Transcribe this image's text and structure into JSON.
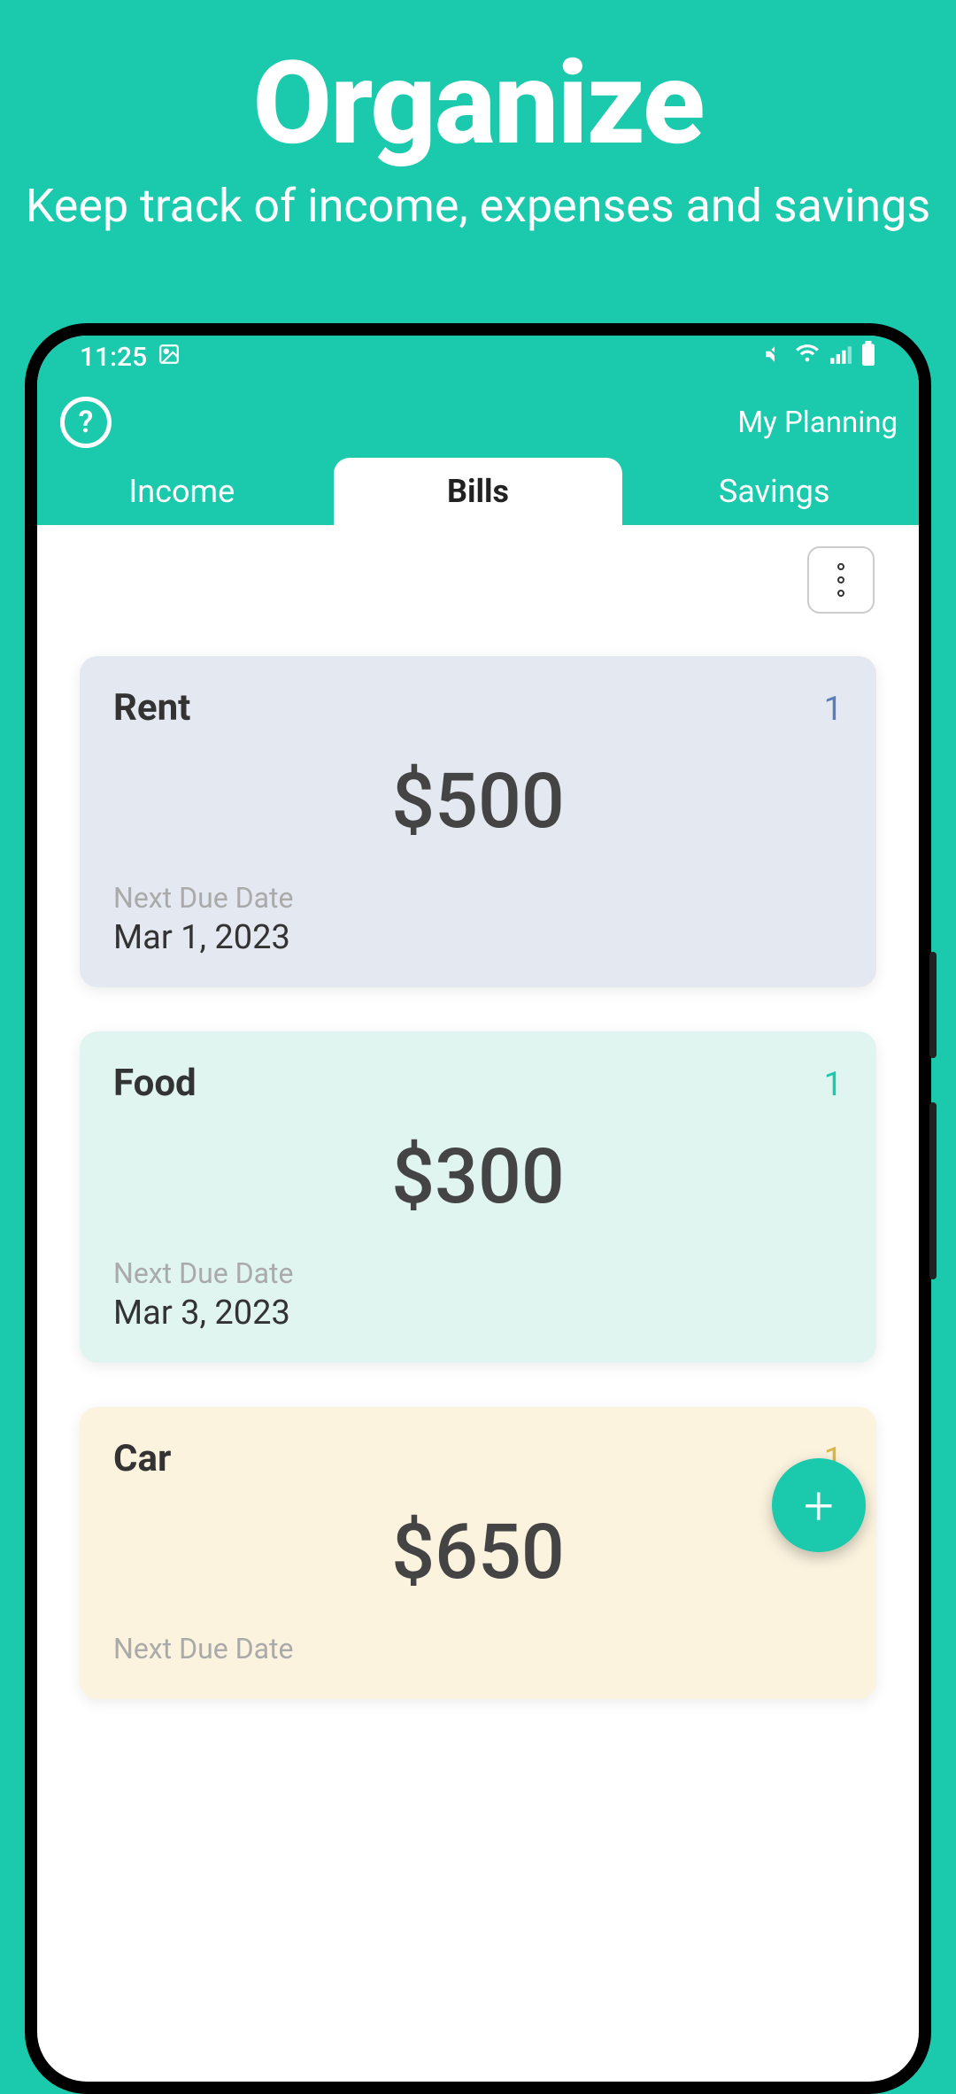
{
  "hero": {
    "title": "Organize",
    "subtitle": "Keep track of income, expenses and savings"
  },
  "status": {
    "time": "11:25"
  },
  "header": {
    "title": "My Planning"
  },
  "tabs": {
    "income": "Income",
    "bills": "Bills",
    "savings": "Savings"
  },
  "bills": [
    {
      "name": "Rent",
      "badge": "1",
      "badge_color": "#5a7fb7",
      "amount": "$500",
      "due_label": "Next Due Date",
      "due_date": "Mar 1, 2023",
      "bg": "#e4e9f1"
    },
    {
      "name": "Food",
      "badge": "1",
      "badge_color": "#1bc9ac",
      "amount": "$300",
      "due_label": "Next Due Date",
      "due_date": "Mar 3, 2023",
      "bg": "#e0f5f0"
    },
    {
      "name": "Car",
      "badge": "1",
      "badge_color": "#d9b84a",
      "amount": "$650",
      "due_label": "Next Due Date",
      "due_date": "",
      "bg": "#fbf3de"
    }
  ]
}
